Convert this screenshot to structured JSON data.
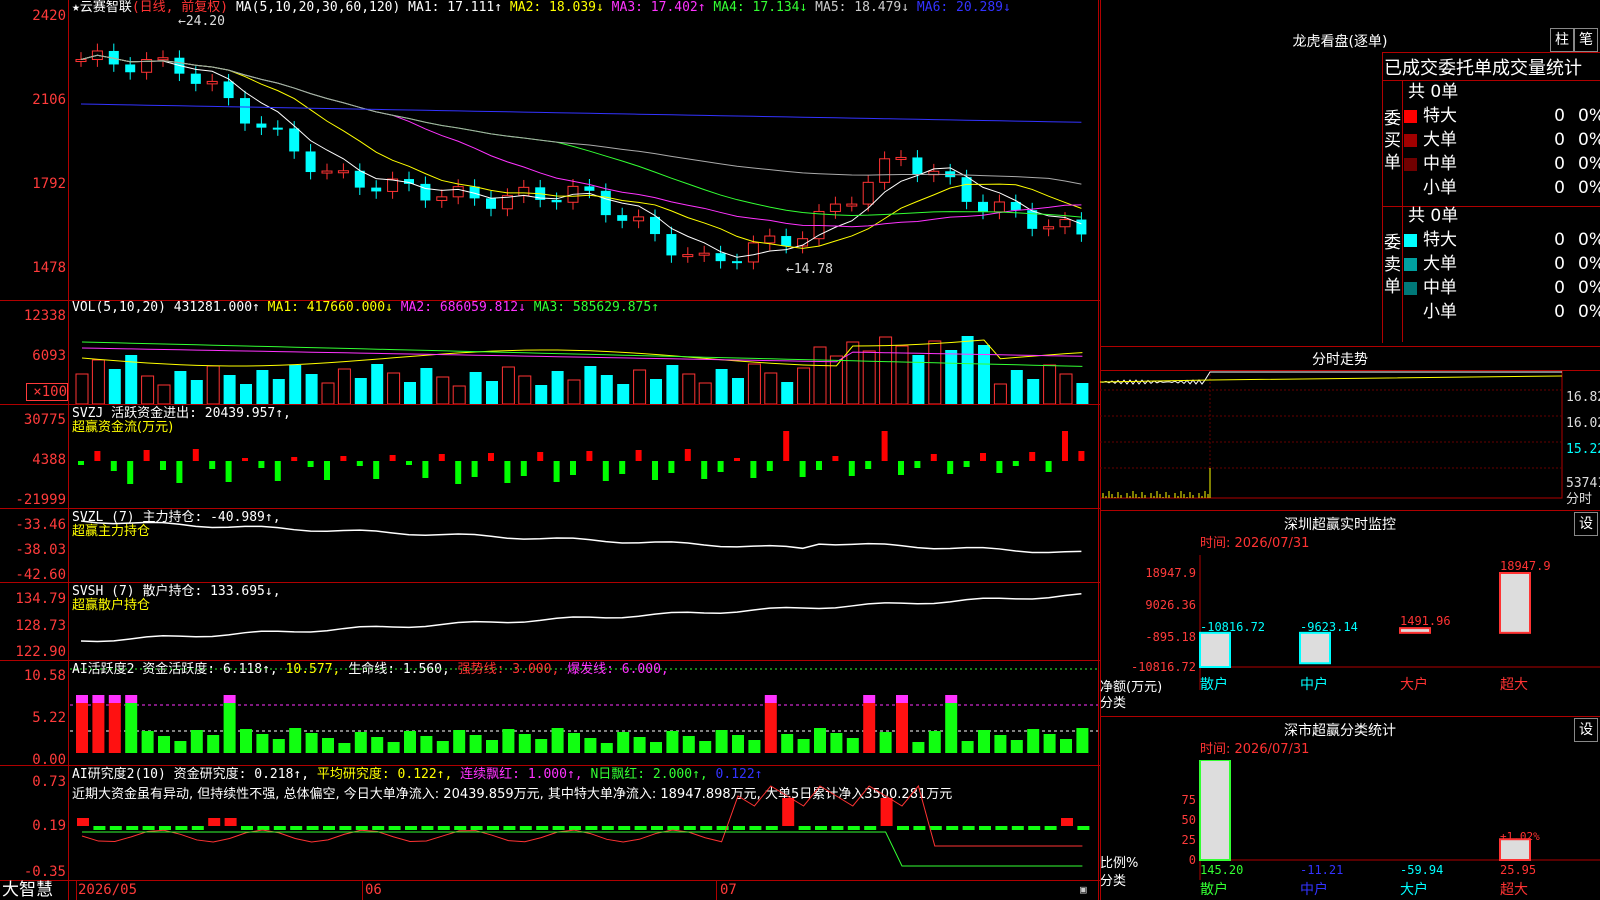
{
  "stock": {
    "name": "★云赛智联",
    "period": "(日线, 前复权)"
  },
  "ma_bar": [
    {
      "label": "MA(5,10,20,30,60,120)",
      "color": "#ffffff"
    },
    {
      "label": "MA1: 17.111↑",
      "color": "#ffffff"
    },
    {
      "label": "MA2: 18.039↓",
      "color": "#ffff00"
    },
    {
      "label": "MA3: 17.402↑",
      "color": "#ff33ff"
    },
    {
      "label": "MA4: 17.134↓",
      "color": "#33ff33"
    },
    {
      "label": "MA5: 18.479↓",
      "color": "#cccccc"
    },
    {
      "label": "MA6: 20.289↓",
      "color": "#3333ff"
    }
  ],
  "price_axis": [
    "2420",
    "2106",
    "1792",
    "1478"
  ],
  "price_marks": {
    "high": "24.20",
    "low": "14.78"
  },
  "vol_bar": [
    {
      "label": "VOL(5,10,20)",
      "color": "#ffffff"
    },
    {
      "label": "431281.000↑",
      "color": "#ffffff"
    },
    {
      "label": "MA1: 417660.000↓",
      "color": "#ffff00"
    },
    {
      "label": "MA2: 686059.812↓",
      "color": "#ff33ff"
    },
    {
      "label": "MA3: 585629.875↑",
      "color": "#33ff33"
    }
  ],
  "vol_axis": [
    "12338",
    "6093",
    "×100"
  ],
  "svzj": {
    "title": "SVZJ  活跃资金进出: 20439.957↑,",
    "sub": "超赢资金流(万元)",
    "axis": [
      "30775",
      "4388",
      "-21999"
    ]
  },
  "svzl": {
    "title": "SVZL (7) 主力持仓: -40.989↑,",
    "sub": "超赢主力持仓",
    "axis": [
      "-33.46",
      "-38.03",
      "-42.60"
    ]
  },
  "svsh": {
    "title": "SVSH (7) 散户持仓: 133.695↓,",
    "sub": "超赢散户持仓",
    "axis": [
      "134.79",
      "128.73",
      "122.90"
    ]
  },
  "ai1": {
    "parts": [
      {
        "t": "AI活跃度2 资金活跃度: 6.118↑,",
        "c": "#ffffff"
      },
      {
        "t": " 10.577,",
        "c": "#ffff00"
      },
      {
        "t": " 生命线: 1.560,",
        "c": "#ffffff"
      },
      {
        "t": " 强势线: 3.000,",
        "c": "#ff3333"
      },
      {
        "t": " 爆发线: 6.000,",
        "c": "#ff33ff"
      }
    ],
    "axis": [
      "10.58",
      "5.22",
      "0.00"
    ]
  },
  "ai2": {
    "parts": [
      {
        "t": "AI研究度2(10) 资金研究度: 0.218↑,",
        "c": "#ffffff"
      },
      {
        "t": " 平均研究度: 0.122↑,",
        "c": "#ffff00"
      },
      {
        "t": " 连续飘红: 1.000↑,",
        "c": "#ff33ff"
      },
      {
        "t": " N日飘红: 2.000↑,",
        "c": "#33ff33"
      },
      {
        "t": " 0.122↑",
        "c": "#3333ff"
      }
    ],
    "comment": "近期大资金虽有异动, 但持续性不强, 总体偏空, 今日大单净流入: 20439.859万元, 其中特大单净流入: 18947.898万元, 大单5日累计净入3500.281万元",
    "axis": [
      "0.73",
      "0.19",
      "-0.35"
    ]
  },
  "bottom": {
    "brand": "大智慧",
    "dates": [
      "2026/05",
      "06",
      "07"
    ]
  },
  "right": {
    "longhu_title": "龙虎看盘(逐单)",
    "btn_zhu": "柱",
    "btn_bi": "笔",
    "stats_title": "已成交委托单成交量统计",
    "buy_label": "委买单",
    "sell_label": "委卖单",
    "buy_total": "共 0单",
    "sell_total": "共 0单",
    "buy_rows": [
      {
        "name": "特大",
        "count": "0",
        "pct": "0%",
        "color": "#ff0000"
      },
      {
        "name": "大单",
        "count": "0",
        "pct": "0%",
        "color": "#a00000"
      },
      {
        "name": "中单",
        "count": "0",
        "pct": "0%",
        "color": "#700000"
      },
      {
        "name": "小单",
        "count": "0",
        "pct": "0%",
        "color": "#000000"
      }
    ],
    "sell_rows": [
      {
        "name": "特大",
        "count": "0",
        "pct": "0%",
        "color": "#00ffff"
      },
      {
        "name": "大单",
        "count": "0",
        "pct": "0%",
        "color": "#00a0a0"
      },
      {
        "name": "中单",
        "count": "0",
        "pct": "0%",
        "color": "#007878"
      },
      {
        "name": "小单",
        "count": "0",
        "pct": "0%",
        "color": "#000000"
      }
    ],
    "fenshi_title": "分时走势",
    "fenshi_axis": [
      "16.82",
      "16.02",
      "15.22",
      "53741",
      "分时"
    ],
    "monitor_title": "深圳超赢实时监控",
    "monitor_btn": "设",
    "monitor_time": "时间: 2026/07/31",
    "monitor_axis": [
      "18947.9",
      "9026.36",
      "-895.18",
      "-10816.72"
    ],
    "monitor_ylabel": "净额(万元)",
    "monitor_xlabel": "分类",
    "monitor_bars": [
      {
        "name": "散户",
        "value": -10816.72,
        "label": "-10816.72",
        "color": "#00ffff"
      },
      {
        "name": "中户",
        "value": -9623.14,
        "label": "-9623.14",
        "color": "#00ffff"
      },
      {
        "name": "大户",
        "value": 1491.96,
        "label": "1491.96",
        "color": "#ff3333"
      },
      {
        "name": "超大",
        "value": 18947.9,
        "label": "18947.9",
        "color": "#ff3333"
      }
    ],
    "stat_title": "深市超赢分类统计",
    "stat_btn": "设",
    "stat_time": "时间: 2026/07/31",
    "stat_axis": [
      "75",
      "50",
      "25",
      "0"
    ],
    "stat_ylabel": "比例%",
    "stat_xlabel": "分类",
    "stat_bars": [
      {
        "name": "散户",
        "value": 145.2,
        "label": "145.20",
        "color": "#33ff33"
      },
      {
        "name": "中户",
        "value": -11.21,
        "label": "-11.21",
        "color": "#3333ff"
      },
      {
        "name": "大户",
        "value": -59.94,
        "label": "-59.94",
        "color": "#00ffff"
      },
      {
        "name": "超大",
        "value": 25.95,
        "label": "25.95",
        "color": "#ff3333",
        "extra": "+1.02%"
      }
    ]
  }
}
